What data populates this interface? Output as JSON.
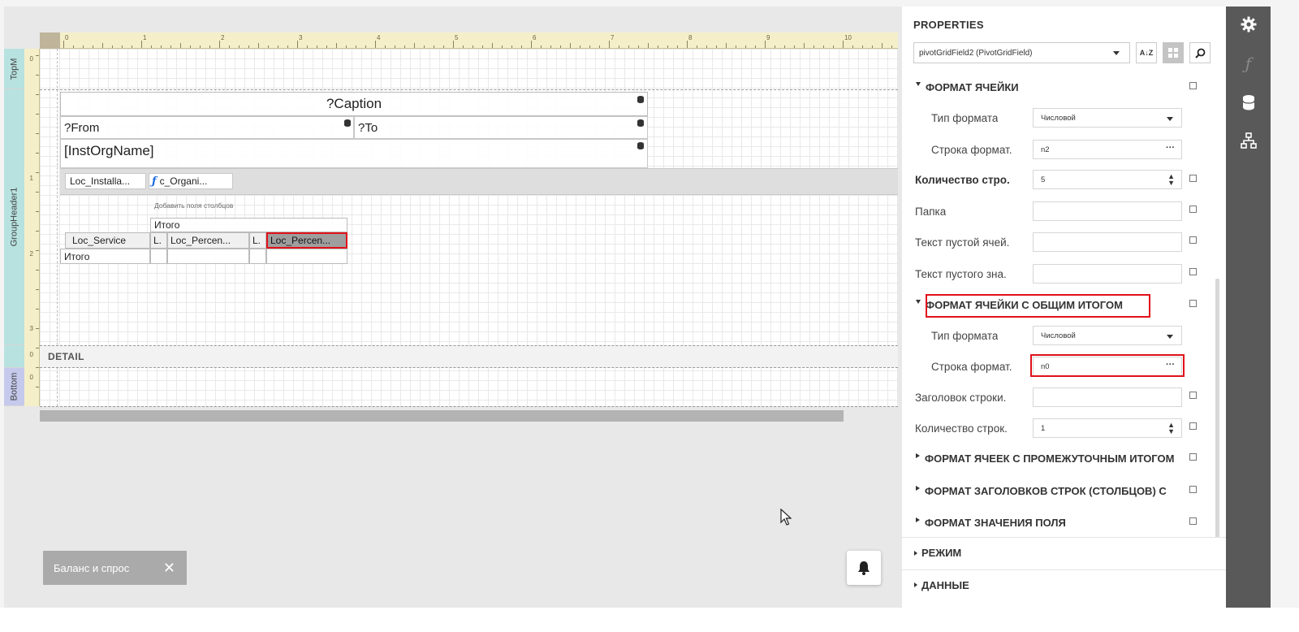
{
  "designer": {
    "band_labels": {
      "top_margin": "TopM",
      "group_header": "GroupHeader1",
      "bottom_margin": "Bottom"
    },
    "ruler_h": [
      "0",
      "1",
      "2",
      "3",
      "4",
      "5",
      "6",
      "7",
      "8",
      "9",
      "10"
    ],
    "ruler_v": [
      "0",
      "1",
      "2",
      "3",
      "0",
      "0"
    ],
    "caption": "?Caption",
    "from": "?From",
    "to": "?To",
    "org_name": "[InstOrgName]",
    "pivot": {
      "row_field_1": "Loc_Installa...",
      "row_field_2": "c_Organi...",
      "add_columns_hint": "Добавить поля столбцов",
      "total_header": "Итого",
      "service_field": "Loc_Service",
      "cell_L1": "L.",
      "cell_percent_1": "Loc_Percen...",
      "cell_L2": "L.",
      "cell_percent_2": "Loc_Percen...",
      "row_total": "Итого"
    },
    "detail_band": "DETAIL",
    "tab_chip": {
      "label": "Баланс и спрос",
      "close": "✕"
    }
  },
  "properties": {
    "title": "PROPERTIES",
    "selected_field": "pivotGridField2 (PivotGridField)",
    "sort_btn": "A↓Z",
    "section_cell_format": "ФОРМАТ ЯЧЕЙКИ",
    "format_type_label": "Тип формата",
    "format_type_value": "Числовой",
    "format_string_label": "Строка формат.",
    "format_string_value": "n2",
    "row_count_label": "Количество стро.",
    "row_count_value": "5",
    "folder_label": "Папка",
    "folder_value": "",
    "empty_cell_text_label": "Текст пустой ячей.",
    "empty_cell_text_value": "",
    "empty_value_text_label": "Текст пустого зна.",
    "empty_value_text_value": "",
    "section_grand_total": "ФОРМАТ ЯЧЕЙКИ С ОБЩИМ ИТОГОМ",
    "gt_format_type_label": "Тип формата",
    "gt_format_type_value": "Числовой",
    "gt_format_string_label": "Строка формат.",
    "gt_format_string_value": "n0",
    "row_header_label": "Заголовок строки.",
    "row_header_value": "",
    "row_count2_label": "Количество строк.",
    "row_count2_value": "1",
    "section_subtotal": "ФОРМАТ ЯЧЕЕК С ПРОМЕЖУТОЧНЫМ ИТОГОМ",
    "section_headers": "ФОРМАТ ЗАГОЛОВКОВ СТРОК (СТОЛБЦОВ) С",
    "section_field_value": "ФОРМАТ ЗНАЧЕНИЯ ПОЛЯ",
    "section_mode": "РЕЖИМ",
    "section_data": "ДАННЫЕ",
    "ellipsis": "···",
    "spinner": "▲▼"
  },
  "sidebar_icons": [
    "gear-icon",
    "function-icon",
    "database-icon",
    "hierarchy-icon"
  ],
  "colors": {
    "highlight": "#e0111a",
    "sidebar_bg": "#595959",
    "band_label_bg": "#b7e2e0",
    "ruler_bg": "#f5efc9"
  }
}
